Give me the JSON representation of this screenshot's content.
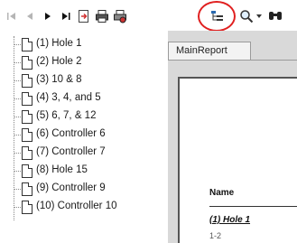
{
  "toolbar": {
    "buttons": [
      {
        "name": "first-page-icon",
        "glyph": "|◀"
      },
      {
        "name": "prev-page-icon",
        "glyph": "◀"
      },
      {
        "name": "next-page-icon",
        "glyph": "▶"
      },
      {
        "name": "last-page-icon",
        "glyph": "▶|"
      },
      {
        "name": "export-icon",
        "glyph": "⇥"
      },
      {
        "name": "print-icon",
        "glyph": "🖶"
      },
      {
        "name": "print-setup-icon",
        "glyph": "🖶"
      },
      {
        "name": "group-tree-icon",
        "glyph": "☷"
      },
      {
        "name": "zoom-icon",
        "glyph": "🔍"
      },
      {
        "name": "zoom-dropdown-icon",
        "glyph": "▾"
      },
      {
        "name": "find-icon",
        "glyph": "👓"
      }
    ],
    "highlight_color": "#e02020"
  },
  "tree": {
    "items": [
      "(1) Hole 1",
      "(2) Hole 2",
      "(3) 10 & 8",
      "(4) 3, 4, and 5",
      "(5) 6, 7, & 12",
      "(6) Controller 6",
      "(7) Controller 7",
      "(8) Hole 15",
      "(9) Controller 9",
      "(10) Controller 10"
    ]
  },
  "report": {
    "tab_label": "MainReport",
    "column_header": "Name",
    "first_row": "(1) Hole 1",
    "first_row_sub": "1-2"
  }
}
